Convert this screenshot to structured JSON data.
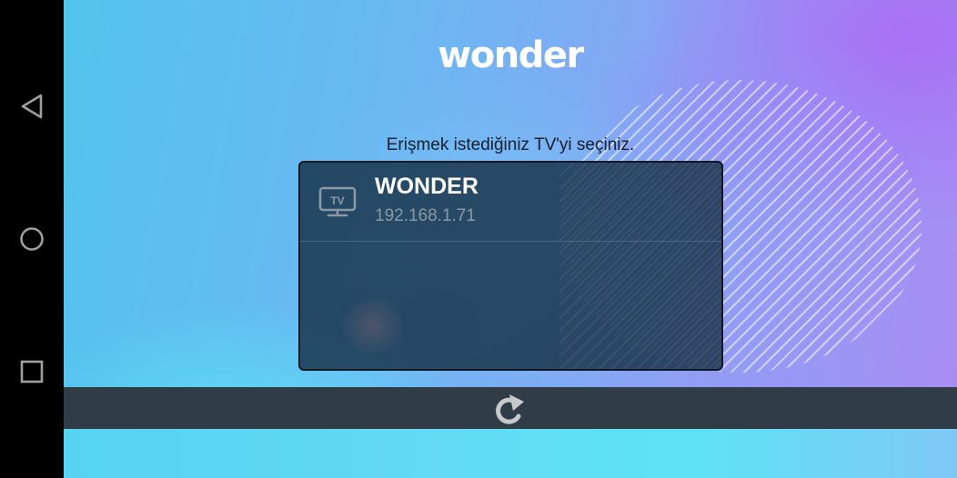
{
  "app": {
    "logo_text": "wonder",
    "prompt": "Erişmek istediğiniz TV'yi seçiniz."
  },
  "devices": [
    {
      "name": "WONDER",
      "ip": "192.168.1.71",
      "icon": "tv-icon",
      "icon_label": "TV"
    }
  ],
  "toolbar": {
    "refresh_icon": "refresh-icon"
  },
  "system_nav": {
    "back_icon": "back-icon",
    "home_icon": "home-icon",
    "recent_icon": "recent-apps-icon"
  },
  "colors": {
    "list_background": "#163046",
    "toolbar_background": "#303c46",
    "device_name": "#ffffff",
    "device_ip": "#8b98a5",
    "prompt_text": "#1a1f2e"
  }
}
